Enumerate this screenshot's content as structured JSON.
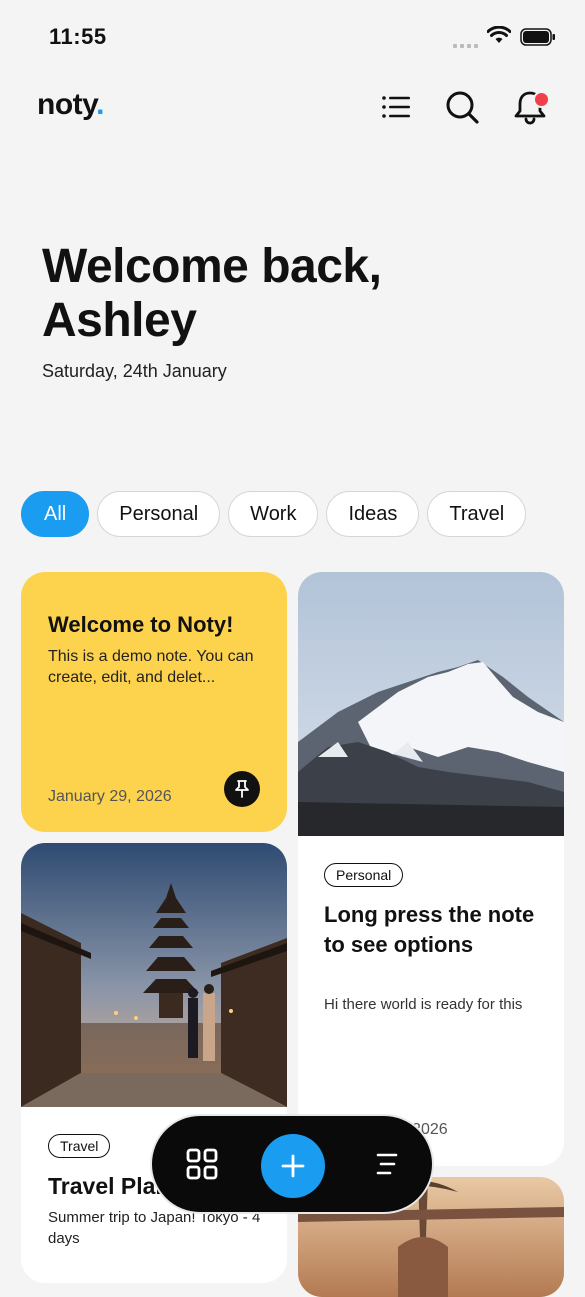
{
  "status_bar": {
    "time": "11:55"
  },
  "header": {
    "logo_text": "noty",
    "logo_dot": ".",
    "icons": [
      "menu-icon",
      "search-icon",
      "bell-icon"
    ]
  },
  "welcome": {
    "line1": "Welcome back,",
    "line2": "Ashley",
    "date": "Saturday, 24th January"
  },
  "filters": [
    {
      "label": "All",
      "active": true
    },
    {
      "label": "Personal"
    },
    {
      "label": "Work"
    },
    {
      "label": "Ideas"
    },
    {
      "label": "Travel"
    }
  ],
  "notes": [
    {
      "title": "Welcome to Noty!",
      "body": "This is a demo note. You can create, edit, and delet...",
      "date": "January 29, 2026",
      "color": "#fdd34e",
      "pinned": true
    },
    {
      "tag": "Personal",
      "title": "Long press the note to see options",
      "body": "Hi there world is ready for this",
      "date": "January 29, 2026",
      "image": "mountain"
    },
    {
      "tag": "Travel",
      "title": "Travel Plans",
      "body": "Summer trip to Japan! Tokyo - 4 days",
      "image": "kyoto-street"
    },
    {
      "image": "sunset"
    }
  ],
  "bottom_bar": {
    "icons": [
      "grid-view-icon",
      "add-icon",
      "sort-icon"
    ]
  },
  "colors": {
    "accent": "#1a9cf0",
    "note_yellow": "#fdd34e",
    "notification": "#f0404a"
  }
}
